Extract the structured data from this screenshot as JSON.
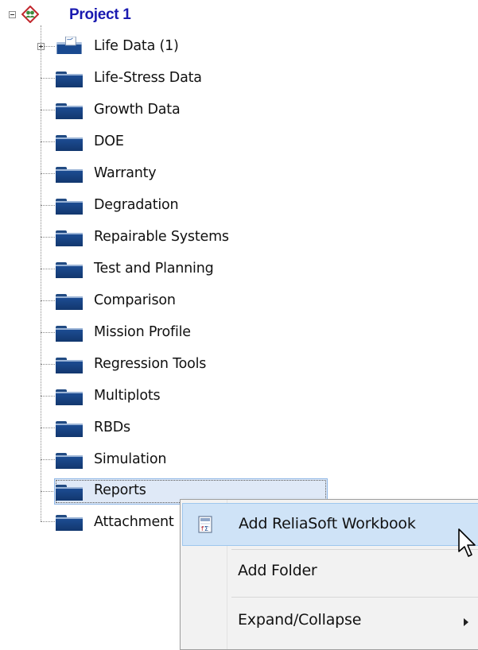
{
  "project": {
    "label": "Project 1"
  },
  "tree_items": [
    {
      "label": "Life Data (1)"
    },
    {
      "label": "Life-Stress Data"
    },
    {
      "label": "Growth Data"
    },
    {
      "label": "DOE"
    },
    {
      "label": "Warranty"
    },
    {
      "label": "Degradation"
    },
    {
      "label": "Repairable Systems"
    },
    {
      "label": "Test and Planning"
    },
    {
      "label": "Comparison"
    },
    {
      "label": "Mission Profile"
    },
    {
      "label": "Regression Tools"
    },
    {
      "label": "Multiplots"
    },
    {
      "label": "RBDs"
    },
    {
      "label": "Simulation"
    },
    {
      "label": "Reports"
    },
    {
      "label": "Attachment"
    }
  ],
  "context_menu": {
    "items": [
      {
        "label": "Add ReliaSoft Workbook",
        "icon": "workbook-icon"
      },
      {
        "label": "Add Folder"
      },
      {
        "label": "Expand/Collapse",
        "icon": "submenu-arrow-icon"
      }
    ]
  },
  "colors": {
    "project_label": "#1a1ab0",
    "folder": "#1c4c92",
    "selection": "#dfe9f7",
    "menu_hover": "#cfe3f7"
  }
}
